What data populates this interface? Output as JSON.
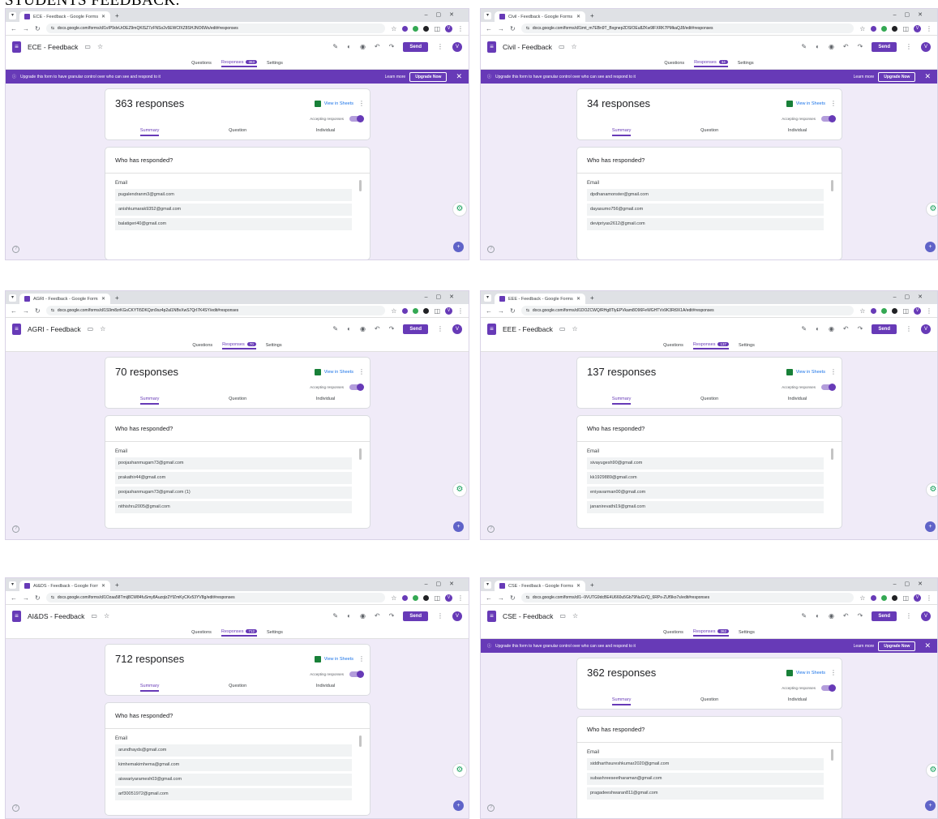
{
  "heading": "STUDENTS FEEDBACK.",
  "common": {
    "questions_tab": "Questions",
    "responses_tab": "Responses",
    "settings_tab": "Settings",
    "send_label": "Send",
    "view_in_sheets": "View in Sheets",
    "accepting": "Accepting responses",
    "summary": "Summary",
    "question": "Question",
    "individual": "Individual",
    "who_title": "Who has responded?",
    "email_header": "Email",
    "banner_text": "Upgrade this form to have granular control over who can see and respond to it",
    "learn_more": "Learn more",
    "upgrade_now": "Upgrade Now",
    "avatar_letter": "V",
    "accent": "#673ab7"
  },
  "shots": [
    {
      "tab_title": "ECE - Feedback - Google Forms",
      "url": "docs.google.com/forms/d/1vIP9dvUrDEZ9mQKlSZ7zFNSo2v5EWCfXZ8SHJNO6Ws/edit#responses",
      "form_title": "ECE - Feedback",
      "count_badge": "363",
      "responses_text": "363 responses",
      "banner": true,
      "emails": [
        "pugalendranm3@gmail.com",
        "anishkumarak9352@gmail.com",
        "balatigeri40@gmail.com"
      ]
    },
    {
      "tab_title": "Civil - Feedback - Google Forms",
      "url": "docs.google.com/forms/d/1imt_m7EBn9T_Bxgnep2DSIOEu8ZKw9lFXRK7PMkaQJ8/edit#responses",
      "form_title": "Civil - Feedback",
      "count_badge": "34",
      "responses_text": "34 responses",
      "banner": true,
      "emails": [
        "dpdhanamonster@gmail.com",
        "dayasumo756@gmail.com",
        "devipriyas2612@gmail.com"
      ]
    },
    {
      "tab_title": "AGRI - Feedback - Google Forms",
      "url": "docs.google.com/forms/d/1S9m8zrKGsCKYTi5DKQzn9sz4p2al1NBvXwS7QrI7K4SY/edit#responses",
      "form_title": "AGRI - Feedback",
      "count_badge": "70",
      "responses_text": "70 responses",
      "banner": false,
      "emails": [
        "poojashanmugam73@gmail.com",
        "prakathir44@gmail.com",
        "poojashanmugam73@gmail.com (1)",
        "nithishru2005@gmail.com"
      ]
    },
    {
      "tab_title": "EEE - Feedback - Google Forms",
      "url": "docs.google.com/forms/d/1DOZCWQ/RHg8TlyEPVkam8O96FeWGHTVv9K3Rt9X1A/edit#responses",
      "form_title": "EEE - Feedback",
      "count_badge": "137",
      "responses_text": "137 responses",
      "banner": false,
      "emails": [
        "sivayugesh90@gmail.com",
        "kk1929889@gmail.com",
        "eniyavarman00@gmail.com",
        "jananirevathi19@gmail.com"
      ]
    },
    {
      "tab_title": "AI&DS - Feedback - Google Forms",
      "url": "docs.google.com/forms/d/1Ozaa58Tmij8CW84fuSmy8Auzqlz2YfZmKyCKv53YV8g/edit#responses",
      "form_title": "AI&DS - Feedback",
      "count_badge": "712",
      "responses_text": "712 responses",
      "banner": false,
      "emails": [
        "arundhayds@gmail.com",
        "kimhemakimhema@gmail.com",
        "aiswariyaramesh03@gmail.com",
        "arf30051972@gmail.com"
      ]
    },
    {
      "tab_title": "CSE - Feedback - Google Forms",
      "url": "docs.google.com/forms/d/1--9VUTG9dcBE4U660u5Gb79NuGVQ_6RPs-ZUf9ko7s/edit#responses",
      "form_title": "CSE - Feedback",
      "count_badge": "362",
      "responses_text": "362 responses",
      "banner": true,
      "emails": [
        "siddharthsureshkumar2020@gmail.com",
        "subashreeseetharaman@gmail.com",
        "pragadeeshwaran811@gmail.com"
      ]
    }
  ]
}
